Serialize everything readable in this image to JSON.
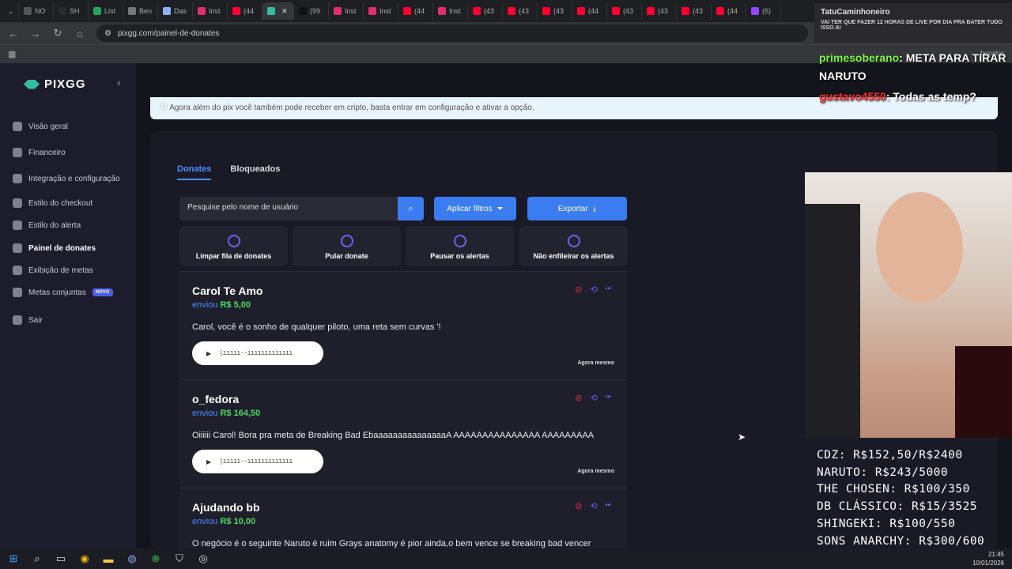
{
  "browser": {
    "tabs": [
      {
        "label": "NO",
        "color": "#555"
      },
      {
        "label": "SH",
        "color": "#2a2a2a"
      },
      {
        "label": "List",
        "color": "#21a464"
      },
      {
        "label": "Ben",
        "color": "#777"
      },
      {
        "label": "Das",
        "color": "#8ab4f8"
      },
      {
        "label": "Inst",
        "color": "#e1306c"
      },
      {
        "label": "(44",
        "color": "#ff0033"
      },
      {
        "label": "",
        "color": "#32bca0",
        "active": true
      },
      {
        "label": "(99",
        "color": "#111"
      },
      {
        "label": "Inst",
        "color": "#e1306c"
      },
      {
        "label": "Inst",
        "color": "#e1306c"
      },
      {
        "label": "(44",
        "color": "#ff0033"
      },
      {
        "label": "Inst",
        "color": "#e1306c"
      },
      {
        "label": "(43",
        "color": "#ff0033"
      },
      {
        "label": "(43",
        "color": "#ff0033"
      },
      {
        "label": "(43",
        "color": "#ff0033"
      },
      {
        "label": "(44",
        "color": "#ff0033"
      },
      {
        "label": "(43",
        "color": "#ff0033"
      },
      {
        "label": "(43",
        "color": "#ff0033"
      },
      {
        "label": "(43",
        "color": "#ff0033"
      },
      {
        "label": "(44",
        "color": "#ff0033"
      },
      {
        "label": "(6)",
        "color": "#9146ff"
      }
    ],
    "url": "pixgg.com/painel-de-donates",
    "favorites_label": "favoritos"
  },
  "sidebar": {
    "logo": "PIXGG",
    "items": [
      {
        "label": "Visão geral"
      },
      {
        "label": "Financeiro"
      },
      {
        "label": "Integração e configuração"
      },
      {
        "label": "Estilo do checkout"
      },
      {
        "label": "Estilo do alerta"
      },
      {
        "label": "Painel de donates",
        "active": true
      },
      {
        "label": "Exibição de metas"
      },
      {
        "label": "Metas conjuntas",
        "badge": "NOVO"
      },
      {
        "label": "Sair"
      }
    ]
  },
  "notice": "Agora além do pix você também pode receber em cripto, basta entrar em configuração e ativar a opção.",
  "tabs": {
    "donates": "Donates",
    "blocked": "Bloqueados"
  },
  "search": {
    "placeholder": "Pesquise pelo nome de usuário"
  },
  "toolbar": {
    "filters": "Aplicar filtros",
    "export": "Exportar"
  },
  "actions": [
    {
      "label": "Limpar fila de donates"
    },
    {
      "label": "Pular donate"
    },
    {
      "label": "Pausar os alertas"
    },
    {
      "label": "Não enfileirar os alertas"
    }
  ],
  "donations": [
    {
      "name": "Carol Te Amo",
      "sent": "enviou",
      "amount": "R$ 5,00",
      "message": "Carol, você é o sonho de qualquer piloto, uma reta sem curvas '!",
      "time": "Agora mesmo"
    },
    {
      "name": "o_fedora",
      "sent": "enviou",
      "amount": "R$ 164,50",
      "message": "Oiiiiii Carol! Bora pra meta de Breaking Bad EbaaaaaaaaaaaaaaaA AAAAAAAAAAAAAAA AAAAAAAAA",
      "time": "Agora mesmo"
    },
    {
      "name": "Ajudando bb",
      "sent": "enviou",
      "amount": "R$ 10,00",
      "message": "O negócio é o seguinte Naruto é ruim Grays anatomy é pior ainda,o bem vence se breaking bad vencer"
    }
  ],
  "stream_overlay": {
    "chat": [
      {
        "user": "TatuCaminhoneiro",
        "text": "VAI TER QUE FAZER 12 HORAS DE LIVE POR DIA PRA BATER TUDO ISSO AI",
        "user_color": "#ffffff"
      },
      {
        "user": "primesoberano",
        "text": ": META PARA TIRAR NARUTO",
        "user_color": "#7cfc3a"
      },
      {
        "user": "gustavo4550",
        "text": ": Todas as temp?",
        "user_color": "#ff3030"
      }
    ],
    "goals": [
      "CDZ: R$152,50/R$2400",
      "NARUTO: R$243/5000",
      "THE CHOSEN: R$100/350",
      "DB CLÁSSICO: R$15/3525",
      "SHINGEKI: R$100/550",
      "SONS ANARCHY: R$300/600"
    ]
  },
  "taskbar": {
    "time": "21:45",
    "date": "10/01/2026"
  }
}
